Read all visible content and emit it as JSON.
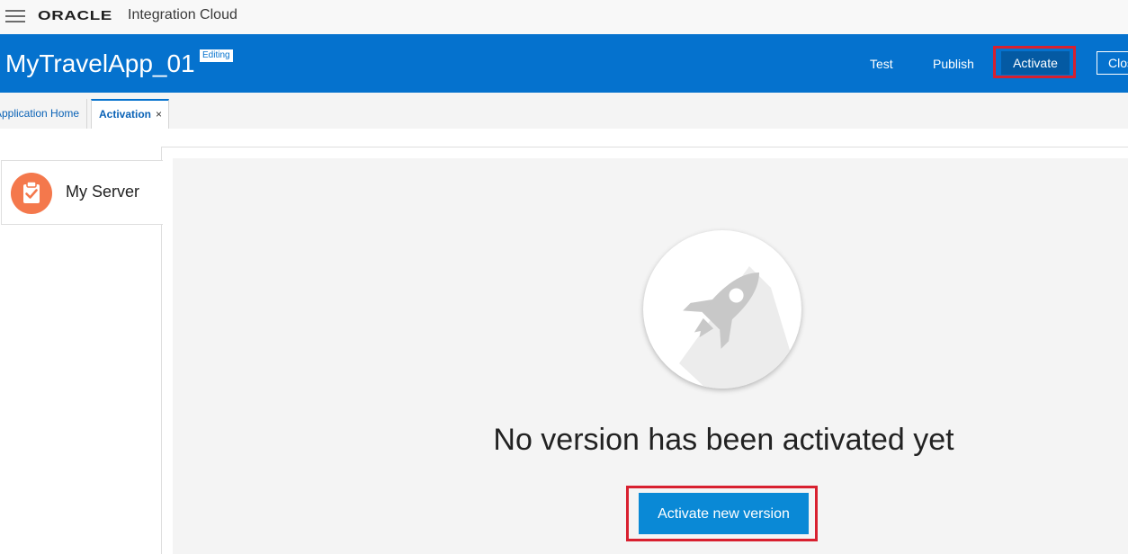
{
  "oracle_bar": {
    "logo": "ORACLE",
    "product": "Integration Cloud",
    "menu_icon": "hamburger-icon"
  },
  "header": {
    "app_title": "MyTravelApp_01",
    "badge": "Editing",
    "actions": {
      "test": "Test",
      "publish": "Publish",
      "activate": "Activate",
      "close": "Close"
    },
    "colors": {
      "header_bg": "#0572ce",
      "highlight_border": "#d8202f"
    }
  },
  "tabs": [
    {
      "label": "Application Home"
    },
    {
      "label": "Activation",
      "close_glyph": "×"
    }
  ],
  "sidebar": {
    "server_name": "My Server",
    "server_icon": "clipboard-check-icon",
    "icon_color": "#f4784c"
  },
  "main": {
    "illustration": "rocket-icon",
    "message": "No version has been activated yet",
    "activate_button": "Activate new version",
    "button_color": "#0a89d6"
  }
}
